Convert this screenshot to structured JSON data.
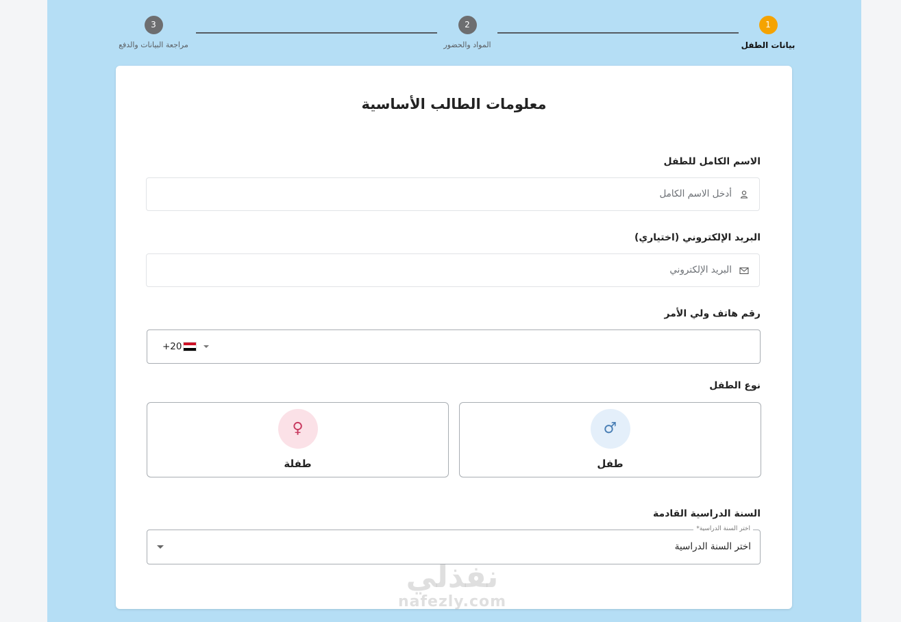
{
  "stepper": {
    "steps": [
      {
        "number": "1",
        "label": "بيانات الطفل",
        "state": "active",
        "color": "#f5a300"
      },
      {
        "number": "2",
        "label": "المواد والحضور",
        "state": "pending",
        "color": "#6d6e70"
      },
      {
        "number": "3",
        "label": "مراجعة البيانات والدفع",
        "state": "pending",
        "color": "#6d6e70"
      }
    ]
  },
  "form": {
    "title": "معلومات الطالب الأساسية",
    "full_name": {
      "label": "الاسم الكامل للطفل",
      "placeholder": "أدخل الاسم الكامل",
      "icon": "user-icon"
    },
    "email": {
      "label": "البريد الإلكتروني (اختياري)",
      "placeholder": "البريد الإلكتروني",
      "icon": "envelope-icon"
    },
    "phone": {
      "label": "رقم هاتف ولي الأمر",
      "country_code": "+20",
      "flag": "egypt-flag-icon",
      "value": ""
    },
    "gender": {
      "label": "نوع الطفل",
      "options": [
        {
          "label": "طفل",
          "icon": "male-icon",
          "color": "#4a7fb5"
        },
        {
          "label": "طفلة",
          "icon": "female-icon",
          "color": "#c8395f"
        }
      ]
    },
    "school_year": {
      "label": "السنة الدراسية القادمة",
      "floating_label": "اختر السنة الدراسية*",
      "value": "اختر السنة الدراسية"
    }
  },
  "watermark": {
    "text": "نفذلي",
    "subtext": "nafezly.com"
  },
  "colors": {
    "background_band": "#b5def5",
    "active_step": "#f5a300",
    "inactive_step": "#6d6e70"
  }
}
